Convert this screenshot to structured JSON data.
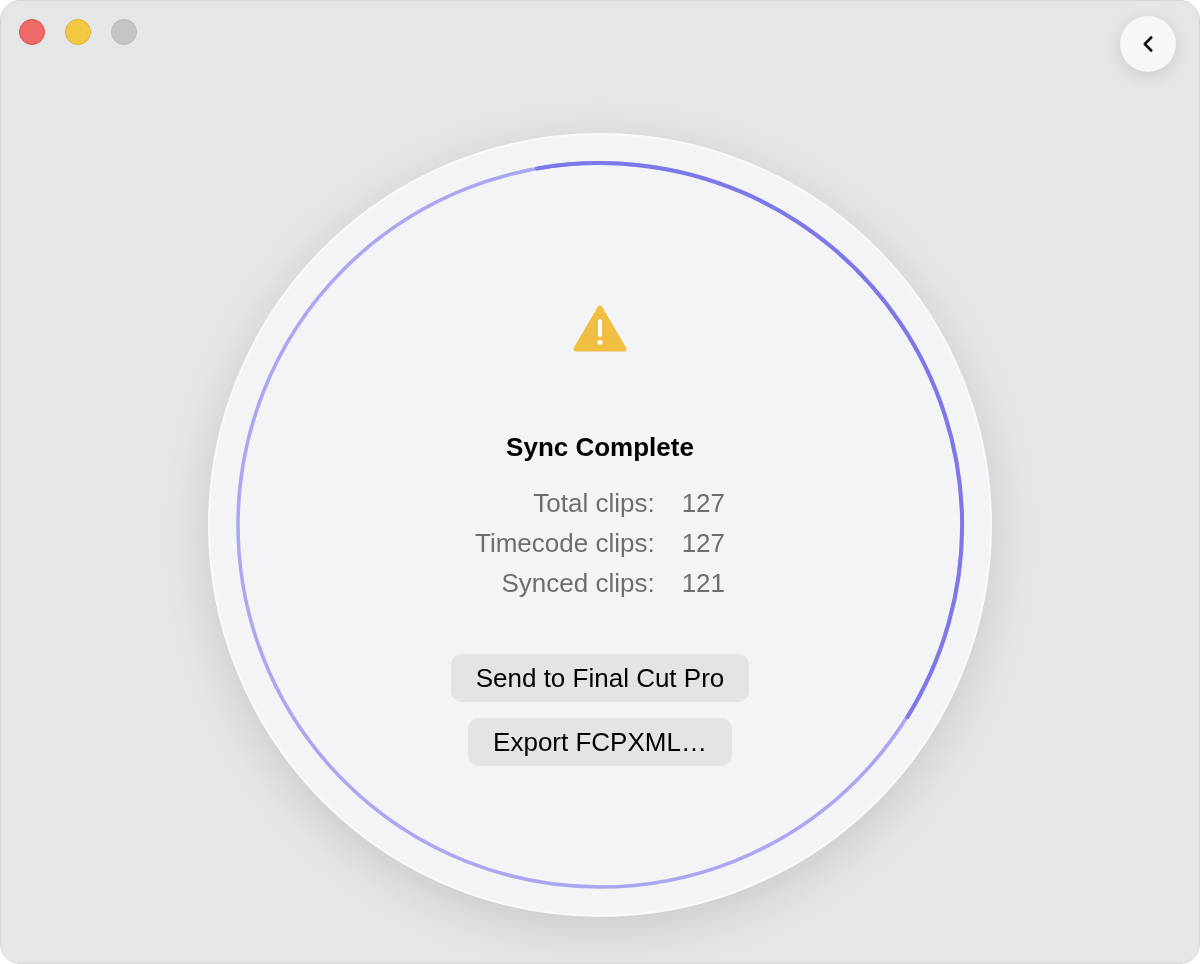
{
  "window_controls": [
    {
      "kind": "close",
      "disabled": false
    },
    {
      "kind": "minimize",
      "disabled": false
    },
    {
      "kind": "zoom",
      "disabled": true
    }
  ],
  "status": {
    "kind": "warning",
    "title": "Sync Complete"
  },
  "stats": [
    {
      "label": "Total clips:",
      "value": "127"
    },
    {
      "label": "Timecode clips:",
      "value": "127"
    },
    {
      "label": "Synced clips:",
      "value": "121"
    }
  ],
  "buttons": [
    "Send to Final Cut Pro",
    "Export FCPXML…"
  ]
}
